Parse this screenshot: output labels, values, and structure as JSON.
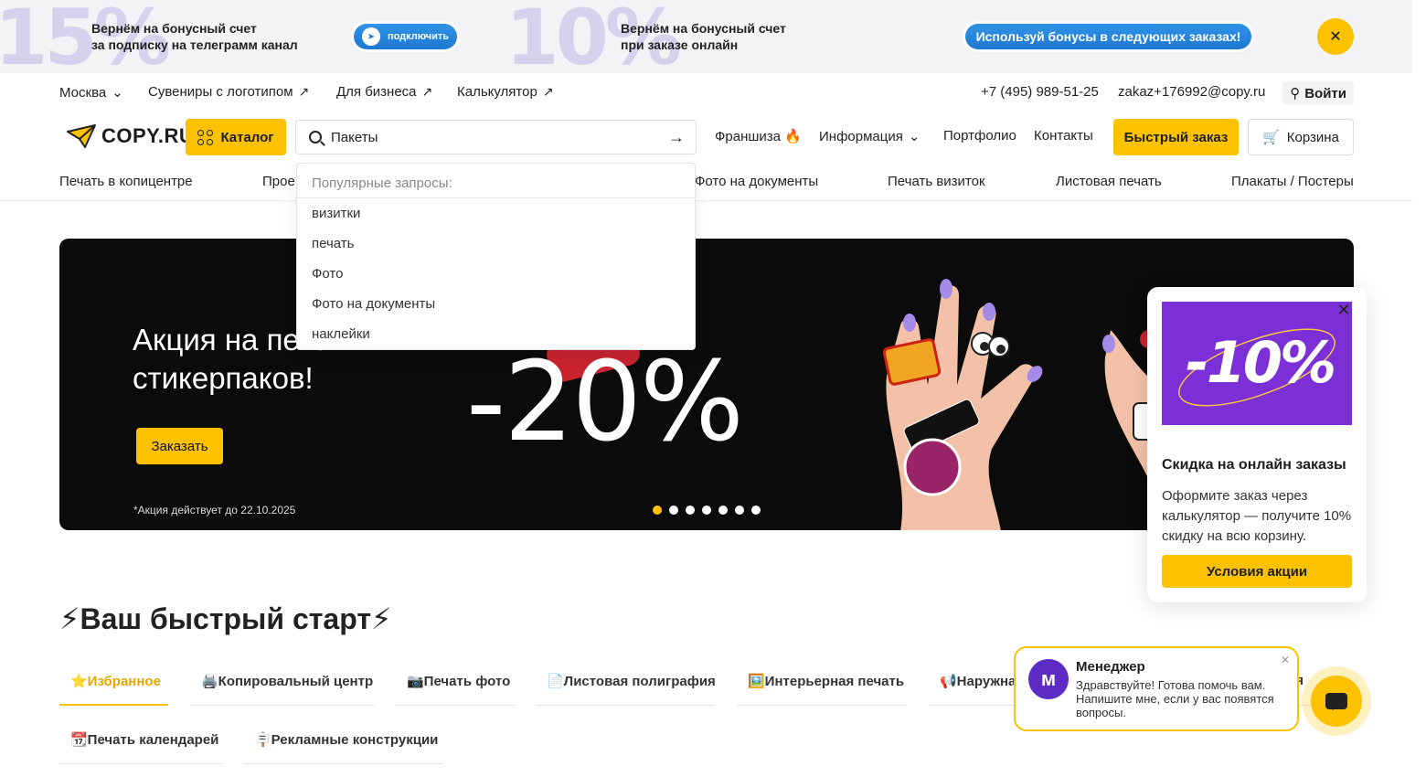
{
  "promo": {
    "pct1": "15%",
    "text1": "Вернём на бонусный счет\nза подписку на телеграмм канал",
    "btn1": "подключить",
    "pct2": "10%",
    "text2": "Вернём на бонусный счет\nпри заказе онлайн",
    "btn2": "Используй бонусы в следующих заказах!"
  },
  "top": {
    "city": "Москва",
    "links": [
      "Сувениры с логотипом",
      "Для бизнеса",
      "Калькулятор"
    ],
    "phone": "+7 (495) 989-51-25",
    "email": "zakaz+176992@copy.ru",
    "login": "Войти"
  },
  "header": {
    "logo": "COPY.RU",
    "catalog": "Каталог",
    "search_value": "Пакеты",
    "nav": [
      "Франшиза 🔥",
      "Информация",
      "Портфолио",
      "Контакты"
    ],
    "quick_order": "Быстрый заказ",
    "cart": "Корзина"
  },
  "categories": [
    "Печать в копицентре",
    "Прое",
    "Фото на документы",
    "Печать визиток",
    "Листовая печать",
    "Плакаты / Постеры"
  ],
  "dropdown": {
    "heading": "Популярные запросы:",
    "items": [
      "визитки",
      "печать",
      "Фото",
      "Фото на документы",
      "наклейки"
    ]
  },
  "banner": {
    "title": "Акция на печать\nстикерпаков!",
    "button": "Заказать",
    "note": "*Акция действует до 22.10.2025",
    "percent": "-20%",
    "slides": 7,
    "active_slide": 1
  },
  "popup": {
    "image_text": "-10%",
    "title": "Скидка на онлайн заказы",
    "text": "Оформите заказ через калькулятор — получите 10% скидку на всю корзину.",
    "button": "Условия акции"
  },
  "quick_start": {
    "title": "⚡Ваш быстрый старт⚡",
    "tabs": [
      "⭐Избранное",
      "🖨️Копировальный центр",
      "📷Печать фото",
      "📄Листовая полиграфия",
      "🖼️Интерьерная печать",
      "📢Наружна",
      "ия",
      "📆Печать календарей",
      "🪧Рекламные конструкции"
    ]
  },
  "chat": {
    "name": "Менеджер",
    "message": "Здравствуйте! Готова помочь вам. Напишите мне, если у вас появятся вопросы."
  },
  "colors": {
    "accent": "#fcc200",
    "promo_blue": "#1f78d1",
    "popup_purple": "#7b2fd6"
  }
}
